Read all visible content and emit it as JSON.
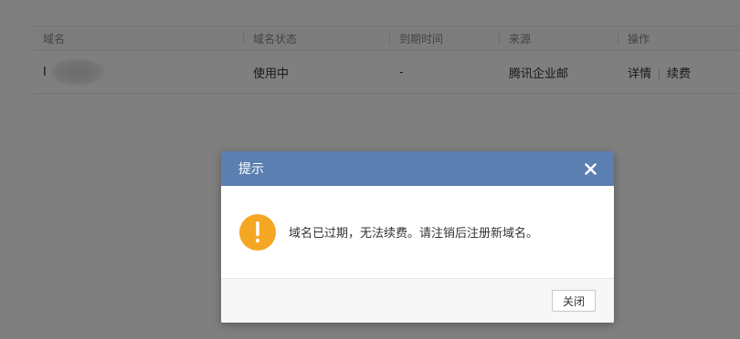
{
  "table": {
    "headers": [
      "域名",
      "域名状态",
      "到期时间",
      "来源",
      "操作"
    ],
    "rows": [
      {
        "domain_visible": "I",
        "status": "使用中",
        "expiry": "-",
        "source": "腾讯企业邮",
        "actions": {
          "details": "详情",
          "renew": "续费"
        }
      }
    ]
  },
  "dialog": {
    "title": "提示",
    "message": "域名已过期，无法续费。请注销后注册新域名。",
    "close_button": "关闭",
    "icons": {
      "warning": "warning-icon",
      "close": "close-icon"
    }
  },
  "colors": {
    "header_bar": "#5c7fb1",
    "warning": "#f5a623",
    "overlay": "rgba(0,0,0,0.5)"
  }
}
